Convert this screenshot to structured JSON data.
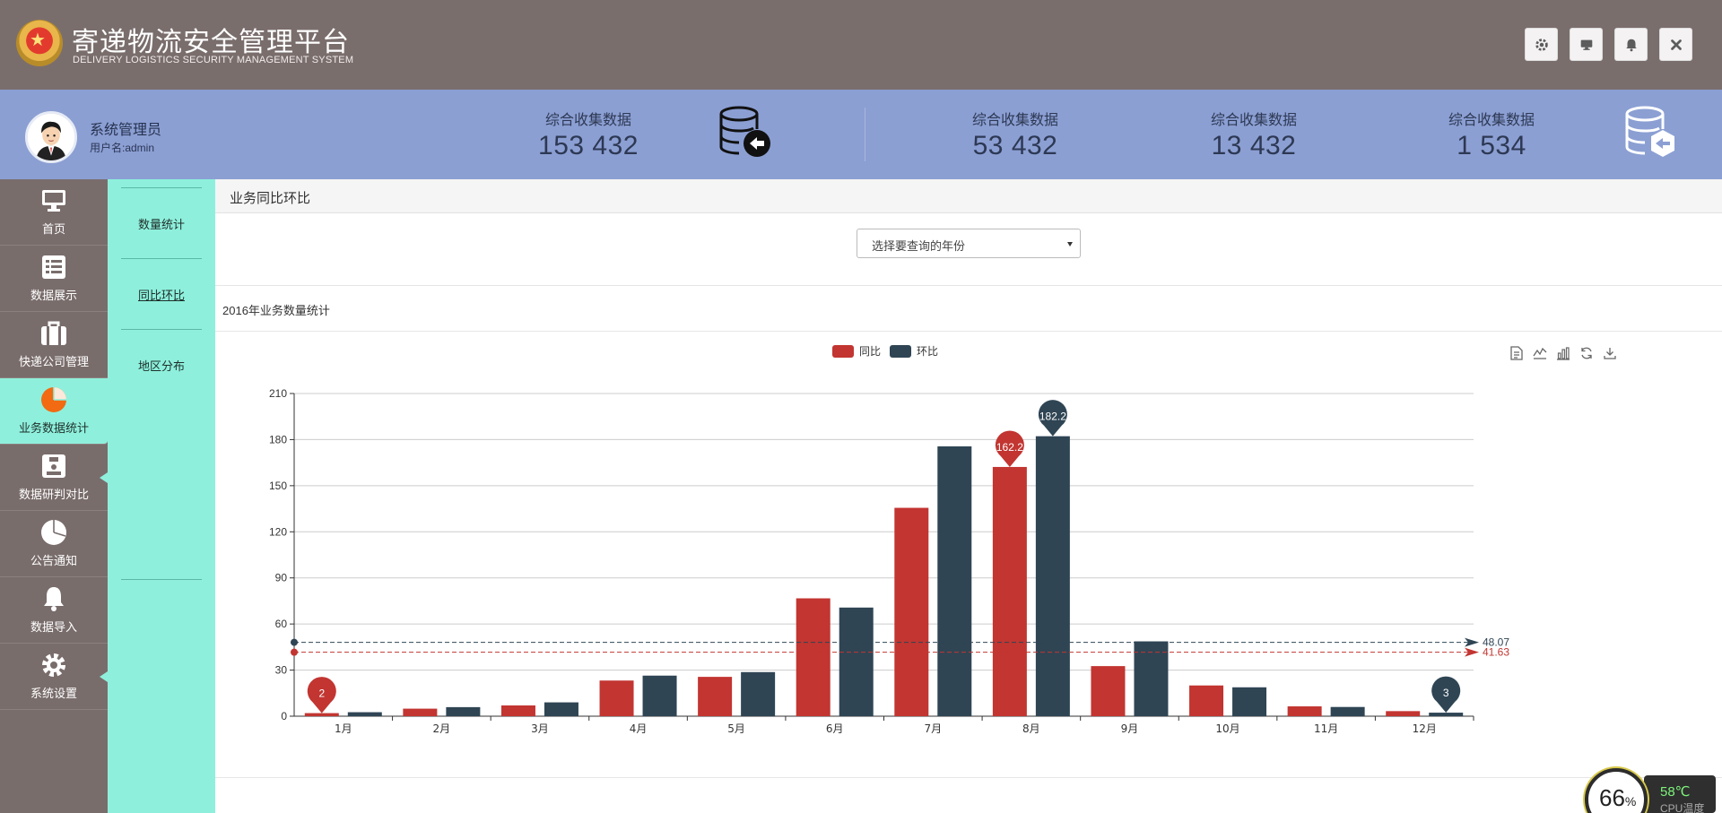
{
  "header": {
    "title_cn": "寄递物流安全管理平台",
    "title_en": "DELIVERY LOGISTICS SECURITY MANAGEMENT SYSTEM",
    "buttons": [
      "gear-icon",
      "monitor-icon",
      "bell-icon",
      "close-icon"
    ]
  },
  "user": {
    "role": "系统管理员",
    "username": "用户名:admin"
  },
  "stats": [
    {
      "label": "综合收集数据",
      "value": "153 432"
    },
    {
      "label": "综合收集数据",
      "value": "53 432"
    },
    {
      "label": "综合收集数据",
      "value": "13 432"
    },
    {
      "label": "综合收集数据",
      "value": "1 534"
    }
  ],
  "nav": {
    "items": [
      {
        "label": "首页",
        "icon": "monitor-icon"
      },
      {
        "label": "数据展示",
        "icon": "list-icon"
      },
      {
        "label": "快递公司管理",
        "icon": "briefcase-icon"
      },
      {
        "label": "业务数据统计",
        "icon": "pie-icon"
      },
      {
        "label": "数据研判对比",
        "icon": "compare-icon"
      },
      {
        "label": "公告通知",
        "icon": "pie-icon"
      },
      {
        "label": "数据导入",
        "icon": "bell-icon"
      },
      {
        "label": "系统设置",
        "icon": "gear-icon"
      }
    ]
  },
  "submenu": {
    "items": [
      "数量统计",
      "同比环比",
      "地区分布"
    ]
  },
  "main": {
    "page_title": "业务同比环比",
    "select_placeholder": "选择要查询的年份",
    "section_title": "2016年业务数量统计"
  },
  "cpu": {
    "value": "66",
    "unit": "%",
    "temp": "58℃",
    "label": "CPU温度"
  },
  "colors": {
    "header": "#7a6e6d",
    "infobar": "#8b9fd3",
    "accent": "#8ef0dc",
    "series_a": "#c23531",
    "series_b": "#2f4554"
  },
  "chart_data": {
    "type": "bar",
    "title": "",
    "categories": [
      "1月",
      "2月",
      "3月",
      "4月",
      "5月",
      "6月",
      "7月",
      "8月",
      "9月",
      "10月",
      "11月",
      "12月"
    ],
    "series": [
      {
        "name": "同比",
        "color": "#c23531",
        "values": [
          2.0,
          4.9,
          7.0,
          23.2,
          25.6,
          76.7,
          135.6,
          162.2,
          32.6,
          20.0,
          6.4,
          3.3
        ]
      },
      {
        "name": "环比",
        "color": "#2f4554",
        "values": [
          2.6,
          5.9,
          9.0,
          26.4,
          28.7,
          70.7,
          175.6,
          182.2,
          48.7,
          18.8,
          6.0,
          2.3
        ]
      }
    ],
    "ylim": [
      0,
      210
    ],
    "yticks": [
      0,
      30,
      60,
      90,
      120,
      150,
      180,
      210
    ],
    "grid": true,
    "legend": "top-center",
    "mark_points": [
      {
        "series": 0,
        "category": "1月",
        "label": "2"
      },
      {
        "series": 0,
        "category": "8月",
        "label": "162.2"
      },
      {
        "series": 1,
        "category": "8月",
        "label": "182.2"
      },
      {
        "series": 1,
        "category": "12月",
        "label": "3"
      }
    ],
    "mark_lines": [
      {
        "series": 0,
        "value": 41.63,
        "label": "41.63"
      },
      {
        "series": 1,
        "value": 48.07,
        "label": "48.07"
      }
    ]
  }
}
